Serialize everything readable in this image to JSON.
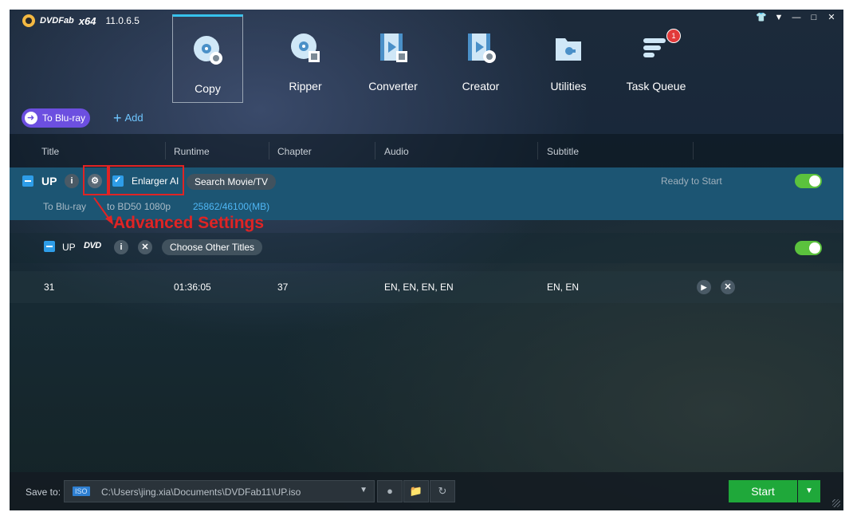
{
  "app": {
    "name": "DVDFab",
    "arch": "x64",
    "version": "11.0.6.5"
  },
  "window_controls": [
    "skin-icon",
    "menu-icon",
    "minimize-icon",
    "maximize-icon",
    "close-icon"
  ],
  "nav": [
    {
      "label": "Copy",
      "icon": "disc-copy-icon",
      "active": true
    },
    {
      "label": "Ripper",
      "icon": "disc-ripper-icon"
    },
    {
      "label": "Converter",
      "icon": "film-converter-icon"
    },
    {
      "label": "Creator",
      "icon": "film-creator-icon"
    },
    {
      "label": "Utilities",
      "icon": "toolbox-icon"
    },
    {
      "label": "Task Queue",
      "icon": "queue-icon",
      "badge": "1"
    }
  ],
  "mode": {
    "label": "To Blu-ray"
  },
  "add": {
    "label": "Add"
  },
  "columns": [
    "Title",
    "Runtime",
    "Chapter",
    "Audio",
    "Subtitle"
  ],
  "title_row": {
    "name": "UP",
    "enlarger_label": "Enlarger AI",
    "search_label": "Search Movie/TV",
    "status": "Ready to Start",
    "target": "To Blu-ray",
    "profile": "to BD50 1080p",
    "size": "25862/46100(MB)"
  },
  "annotation": {
    "text": "Advanced Settings",
    "color": "#e02424"
  },
  "sub_row": {
    "name": "UP",
    "dvd_logo": "DVD",
    "choose_label": "Choose Other Titles"
  },
  "data_row": {
    "title": "31",
    "runtime": "01:36:05",
    "chapter": "37",
    "audio": "EN, EN, EN, EN",
    "subtitle": "EN, EN"
  },
  "bottom": {
    "save_label": "Save to:",
    "iso_badge": "ISO",
    "path": "C:\\Users\\jing.xia\\Documents\\DVDFab11\\UP.iso",
    "start_label": "Start"
  },
  "colors": {
    "accent": "#36c2ec",
    "toggle_on": "#5bc23d",
    "start": "#1fa83a",
    "mode_pill": "#6c4fe0",
    "selected_row": "#1c5573"
  }
}
